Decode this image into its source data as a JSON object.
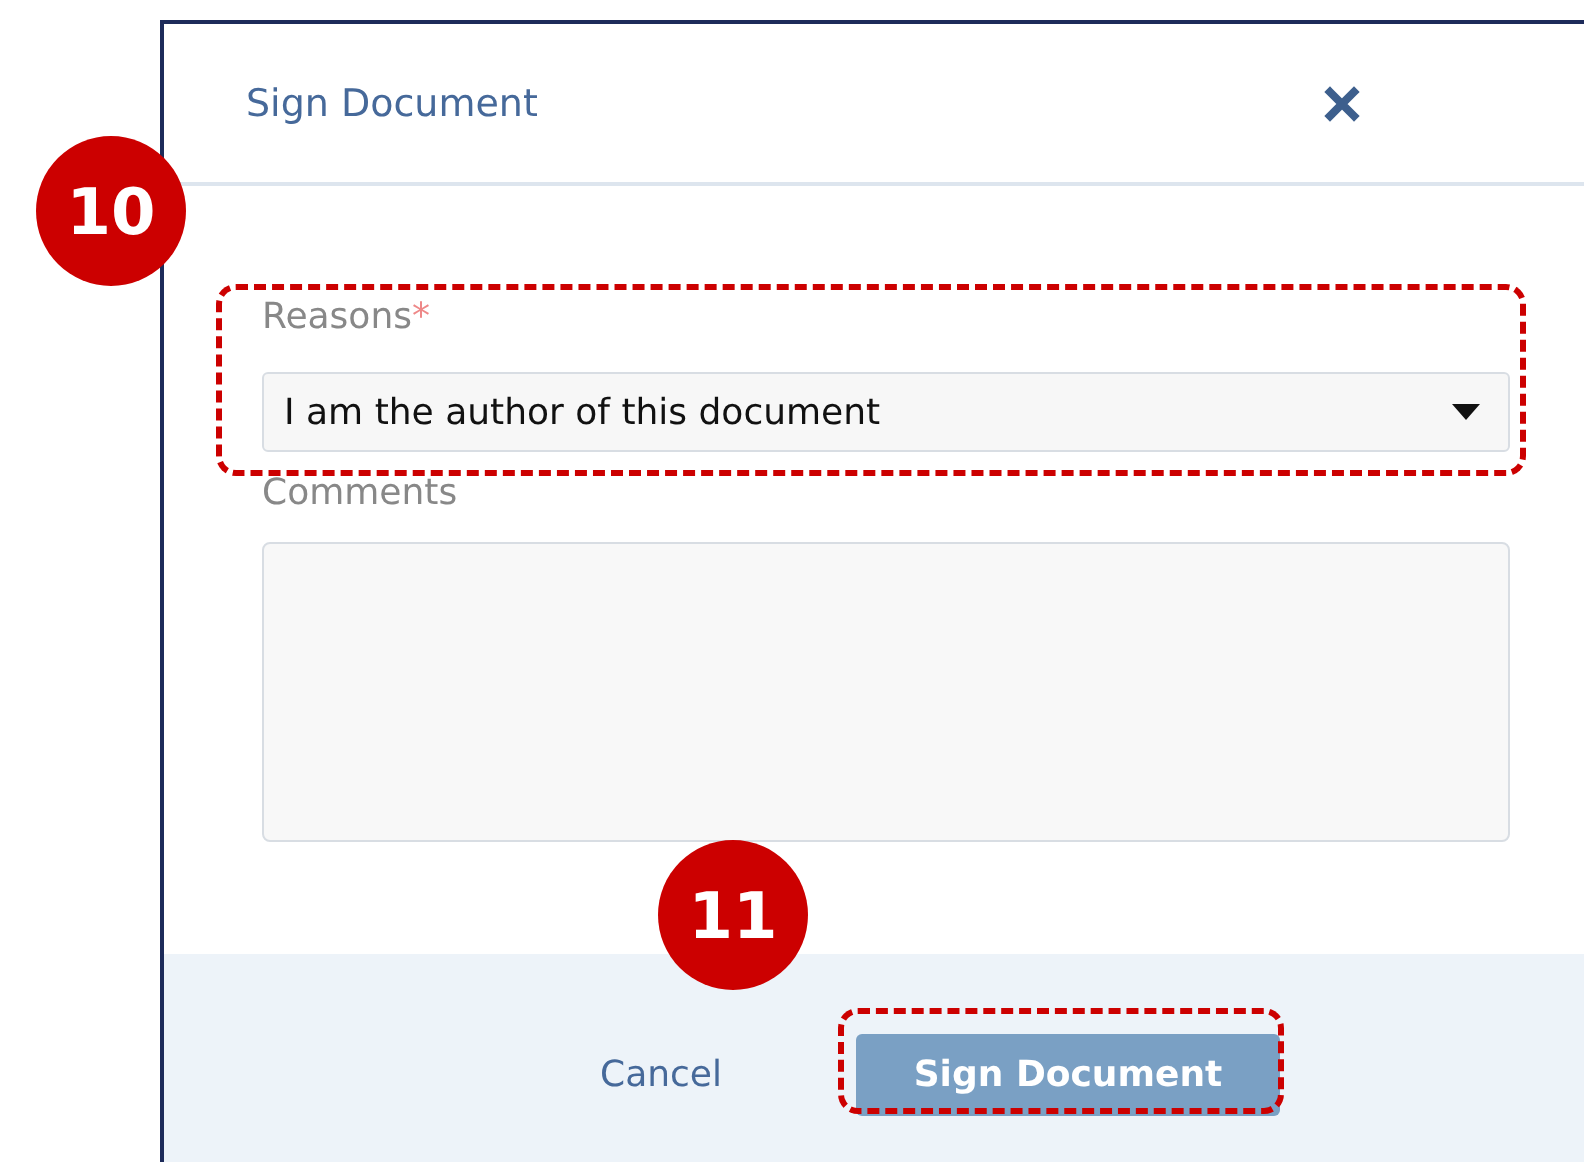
{
  "dialog": {
    "title": "Sign Document",
    "fields": [
      {
        "kind": "select",
        "label": "Reasons",
        "required_mark": "*",
        "value": "I am the author of this document"
      },
      {
        "kind": "textarea",
        "label": "Comments"
      }
    ],
    "buttons": [
      {
        "kind": "link",
        "label": "Cancel"
      },
      {
        "kind": "primary",
        "label": "Sign Document"
      }
    ]
  },
  "callouts": [
    {
      "label": "10"
    },
    {
      "label": "11"
    }
  ]
}
